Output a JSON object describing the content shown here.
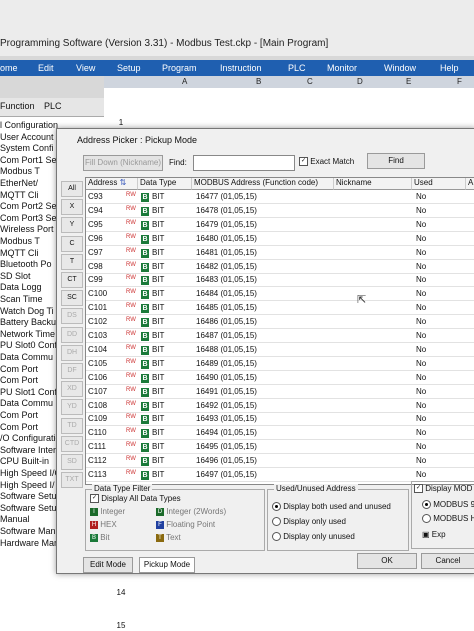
{
  "window": {
    "title": "Programming Software (Version 3.31) - Modbus Test.ckp - [Main Program]"
  },
  "menu": [
    "ome",
    "Edit",
    "View",
    "Setup",
    "Program",
    "Instruction",
    "PLC",
    "Monitor",
    "Window",
    "Help"
  ],
  "columns": [
    "A",
    "B",
    "C",
    "D",
    "E",
    "F"
  ],
  "tree": {
    "tabs": [
      "Function",
      "PLC"
    ],
    "items": [
      "l Configuration",
      "User Account",
      "System Confi",
      "Com Port1 Se",
      "Modbus T",
      "EtherNet/",
      "MQTT Cli",
      "Com Port2 Se",
      "Com Port3 Se",
      "Wireless Port",
      "Modbus T",
      "MQTT Cli",
      "Bluetooth Po",
      "SD Slot",
      "Data Logg",
      "Scan Time",
      "Watch Dog Ti",
      "Battery Backu",
      "Network Time",
      "PU Slot0 Config",
      "Data Commu",
      "Com Port",
      "Com Port",
      "PU Slot1 Config",
      "Data Commu",
      "Com Port",
      "Com Port",
      "/O Configuration",
      "Software Inter",
      "CPU Built-in",
      "High Speed I/O",
      "High Speed I/",
      "Software Setup",
      "Software Setup",
      "Manual",
      "Software Manual",
      "Hardware Manual"
    ]
  },
  "ladder": {
    "rows": [
      "1",
      "14",
      "15"
    ]
  },
  "dialog": {
    "title": "Address Picker : Pickup Mode",
    "fill_down": "Fill Down (Nickname)",
    "find_label": "Find:",
    "exact_match": "Exact Match",
    "find_button": "Find",
    "side_buttons": [
      "All",
      "X",
      "Y",
      "C",
      "T",
      "CT",
      "SC",
      "DS",
      "DD",
      "DH",
      "DF",
      "XD",
      "YD",
      "TD",
      "CTD",
      "SD",
      "TXT"
    ],
    "headers": [
      "Address",
      "Data Type",
      "MODBUS Address (Function code)",
      "Nickname",
      "Used",
      "A"
    ],
    "rw": "RW",
    "rows": [
      {
        "address": "C93",
        "type": "BIT",
        "modbus": "16477 (01,05,15)",
        "used": "No"
      },
      {
        "address": "C94",
        "type": "BIT",
        "modbus": "16478 (01,05,15)",
        "used": "No"
      },
      {
        "address": "C95",
        "type": "BIT",
        "modbus": "16479 (01,05,15)",
        "used": "No"
      },
      {
        "address": "C96",
        "type": "BIT",
        "modbus": "16480 (01,05,15)",
        "used": "No"
      },
      {
        "address": "C97",
        "type": "BIT",
        "modbus": "16481 (01,05,15)",
        "used": "No"
      },
      {
        "address": "C98",
        "type": "BIT",
        "modbus": "16482 (01,05,15)",
        "used": "No"
      },
      {
        "address": "C99",
        "type": "BIT",
        "modbus": "16483 (01,05,15)",
        "used": "No"
      },
      {
        "address": "C100",
        "type": "BIT",
        "modbus": "16484 (01,05,15)",
        "used": "No"
      },
      {
        "address": "C101",
        "type": "BIT",
        "modbus": "16485 (01,05,15)",
        "used": "No"
      },
      {
        "address": "C102",
        "type": "BIT",
        "modbus": "16486 (01,05,15)",
        "used": "No"
      },
      {
        "address": "C103",
        "type": "BIT",
        "modbus": "16487 (01,05,15)",
        "used": "No"
      },
      {
        "address": "C104",
        "type": "BIT",
        "modbus": "16488 (01,05,15)",
        "used": "No"
      },
      {
        "address": "C105",
        "type": "BIT",
        "modbus": "16489 (01,05,15)",
        "used": "No"
      },
      {
        "address": "C106",
        "type": "BIT",
        "modbus": "16490 (01,05,15)",
        "used": "No"
      },
      {
        "address": "C107",
        "type": "BIT",
        "modbus": "16491 (01,05,15)",
        "used": "No"
      },
      {
        "address": "C108",
        "type": "BIT",
        "modbus": "16492 (01,05,15)",
        "used": "No"
      },
      {
        "address": "C109",
        "type": "BIT",
        "modbus": "16493 (01,05,15)",
        "used": "No"
      },
      {
        "address": "C110",
        "type": "BIT",
        "modbus": "16494 (01,05,15)",
        "used": "No"
      },
      {
        "address": "C111",
        "type": "BIT",
        "modbus": "16495 (01,05,15)",
        "used": "No"
      },
      {
        "address": "C112",
        "type": "BIT",
        "modbus": "16496 (01,05,15)",
        "used": "No"
      },
      {
        "address": "C113",
        "type": "BIT",
        "modbus": "16497 (01,05,15)",
        "used": "No"
      }
    ],
    "filter": {
      "legend": "Data Type Filter",
      "all": "Display All Data Types",
      "items": [
        {
          "icon": "I",
          "color": "#1b6a2a",
          "label": "Integer"
        },
        {
          "icon": "D",
          "color": "#1b6a2a",
          "label": "Integer (2Words)"
        },
        {
          "icon": "H",
          "color": "#b02020",
          "label": "HEX"
        },
        {
          "icon": "F",
          "color": "#2040a0",
          "label": "Floating Point"
        },
        {
          "icon": "B",
          "color": "#1b7a3a",
          "label": "Bit"
        },
        {
          "icon": "T",
          "color": "#8a6a10",
          "label": "Text"
        }
      ]
    },
    "usage": {
      "legend": "Used/Unused Address",
      "options": [
        "Display both used and unused",
        "Display only used",
        "Display only unused"
      ]
    },
    "modbus_box": {
      "check": "Display MOD",
      "opt1": "MODBUS 98",
      "opt2": "MODBUS HE",
      "btn": "Exp"
    },
    "ok": "OK",
    "cancel": "Cancel",
    "edit_mode": "Edit Mode",
    "pickup_mode": "Pickup Mode"
  }
}
